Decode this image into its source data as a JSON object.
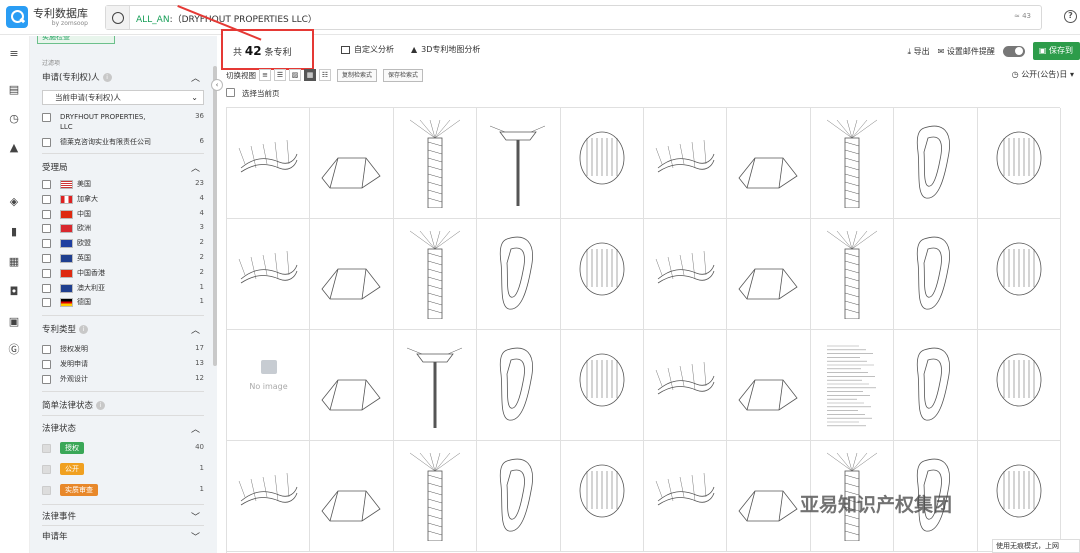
{
  "app": {
    "title": "专利数据库",
    "subtitle": "by zomsoop"
  },
  "search": {
    "query_prefix": "ALL_AN",
    "query_body": ":（DRYFHOUT PROPERTIES LLC）",
    "count": "≈ 43"
  },
  "sidebar": {
    "top_button": "实施检查",
    "hint": "过滤项",
    "applicant": {
      "title": "申请(专利权)人",
      "select_value": "当前申请(专利权)人",
      "items": [
        {
          "label": "DRYFHOUT PROPERTIES,",
          "label2": "LLC",
          "count": "36"
        },
        {
          "label": "德莱克咨询实业有限责任公司",
          "count": "6"
        }
      ]
    },
    "office": {
      "title": "受理局",
      "items": [
        {
          "label": "美国",
          "count": "23",
          "flag": "us"
        },
        {
          "label": "加拿大",
          "count": "4",
          "flag": "ca"
        },
        {
          "label": "中国",
          "count": "4",
          "flag": "cn"
        },
        {
          "label": "欧洲",
          "count": "3",
          "flag": "ep"
        },
        {
          "label": "欧盟",
          "count": "2",
          "flag": "eu"
        },
        {
          "label": "英国",
          "count": "2",
          "flag": "gb"
        },
        {
          "label": "中国香港",
          "count": "2",
          "flag": "hk"
        },
        {
          "label": "澳大利亚",
          "count": "1",
          "flag": "au"
        },
        {
          "label": "德国",
          "count": "1",
          "flag": "de"
        }
      ]
    },
    "type": {
      "title": "专利类型",
      "items": [
        {
          "label": "授权发明",
          "count": "17"
        },
        {
          "label": "发明申请",
          "count": "13"
        },
        {
          "label": "外观设计",
          "count": "12"
        }
      ]
    },
    "simple_status": {
      "title": "简单法律状态"
    },
    "legal_status": {
      "title": "法律状态",
      "items": [
        {
          "label": "授权",
          "count": "40",
          "color": "#3aa757"
        },
        {
          "label": "公开",
          "count": "1",
          "color": "#f0a020"
        },
        {
          "label": "实质审查",
          "count": "1",
          "color": "#e8882a"
        }
      ]
    },
    "events": {
      "title": "法律事件"
    },
    "app_year": {
      "title": "申请年"
    }
  },
  "toolbar": {
    "result_prefix": "共",
    "result_count": "42",
    "result_suffix": "条专利",
    "custom_analysis": "自定义分析",
    "map_3d": "3D专利地图分析",
    "export": "导出",
    "email_alert": "设置邮件提醒",
    "save_to": "保存到"
  },
  "viewbar": {
    "label": "切换视图",
    "copy_query": "复制检索式",
    "save_query": "保存检索式",
    "sort": "公开(公告)日",
    "select_page": "选择当前页"
  },
  "grid": {
    "no_image_text": "No image",
    "cells": [
      "drawing",
      "drawing",
      "drawing",
      "razor",
      "drawing",
      "drawing",
      "drawing",
      "drawing",
      "drawing",
      "drawing",
      "drawing",
      "drawing",
      "drawing",
      "drawing",
      "drawing",
      "drawing",
      "drawing",
      "drawing",
      "drawing",
      "drawing",
      "noimage",
      "drawing",
      "razor",
      "drawing",
      "drawing",
      "drawing",
      "drawing",
      "document",
      "drawing",
      "drawing",
      "drawing",
      "drawing",
      "drawing",
      "drawing",
      "drawing",
      "drawing",
      "drawing",
      "drawing",
      "drawing",
      "drawing"
    ]
  },
  "watermark": "亚易知识产权集团",
  "corner_note": "使用无痕模式，上网"
}
